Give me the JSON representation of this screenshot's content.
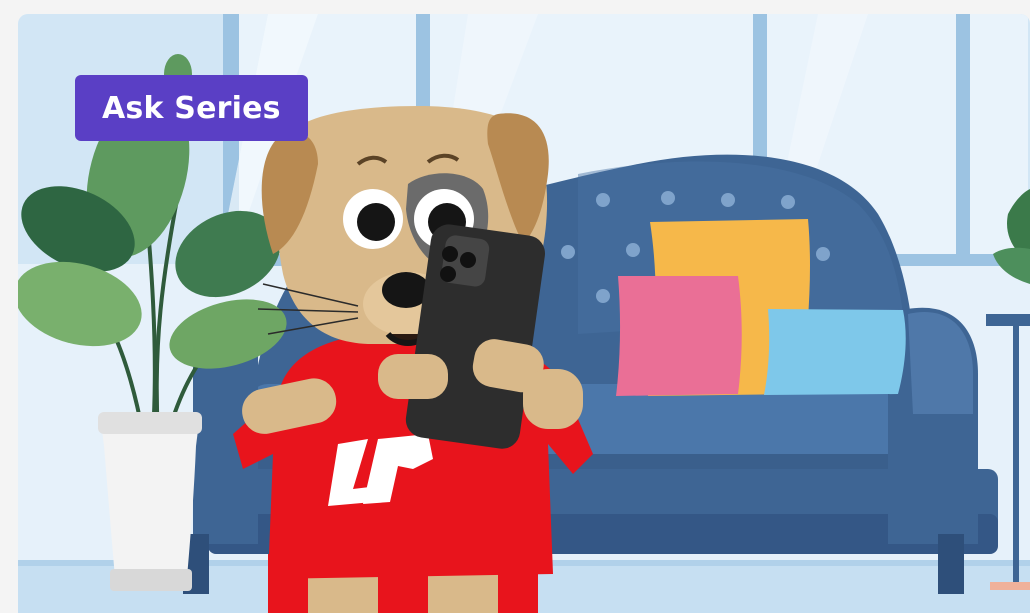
{
  "card": {
    "badge": {
      "label": "Ask Series"
    },
    "illustration": {
      "description_icon": "dog-with-phone-illustration",
      "shirt_logo": "LP"
    }
  },
  "colors": {
    "badge_bg": "#5a3fc5",
    "badge_text": "#ffffff",
    "sofa": "#3e6594",
    "shirt": "#e8141c",
    "dog_fur": "#d9b98a",
    "background": "#e4f0fa"
  }
}
